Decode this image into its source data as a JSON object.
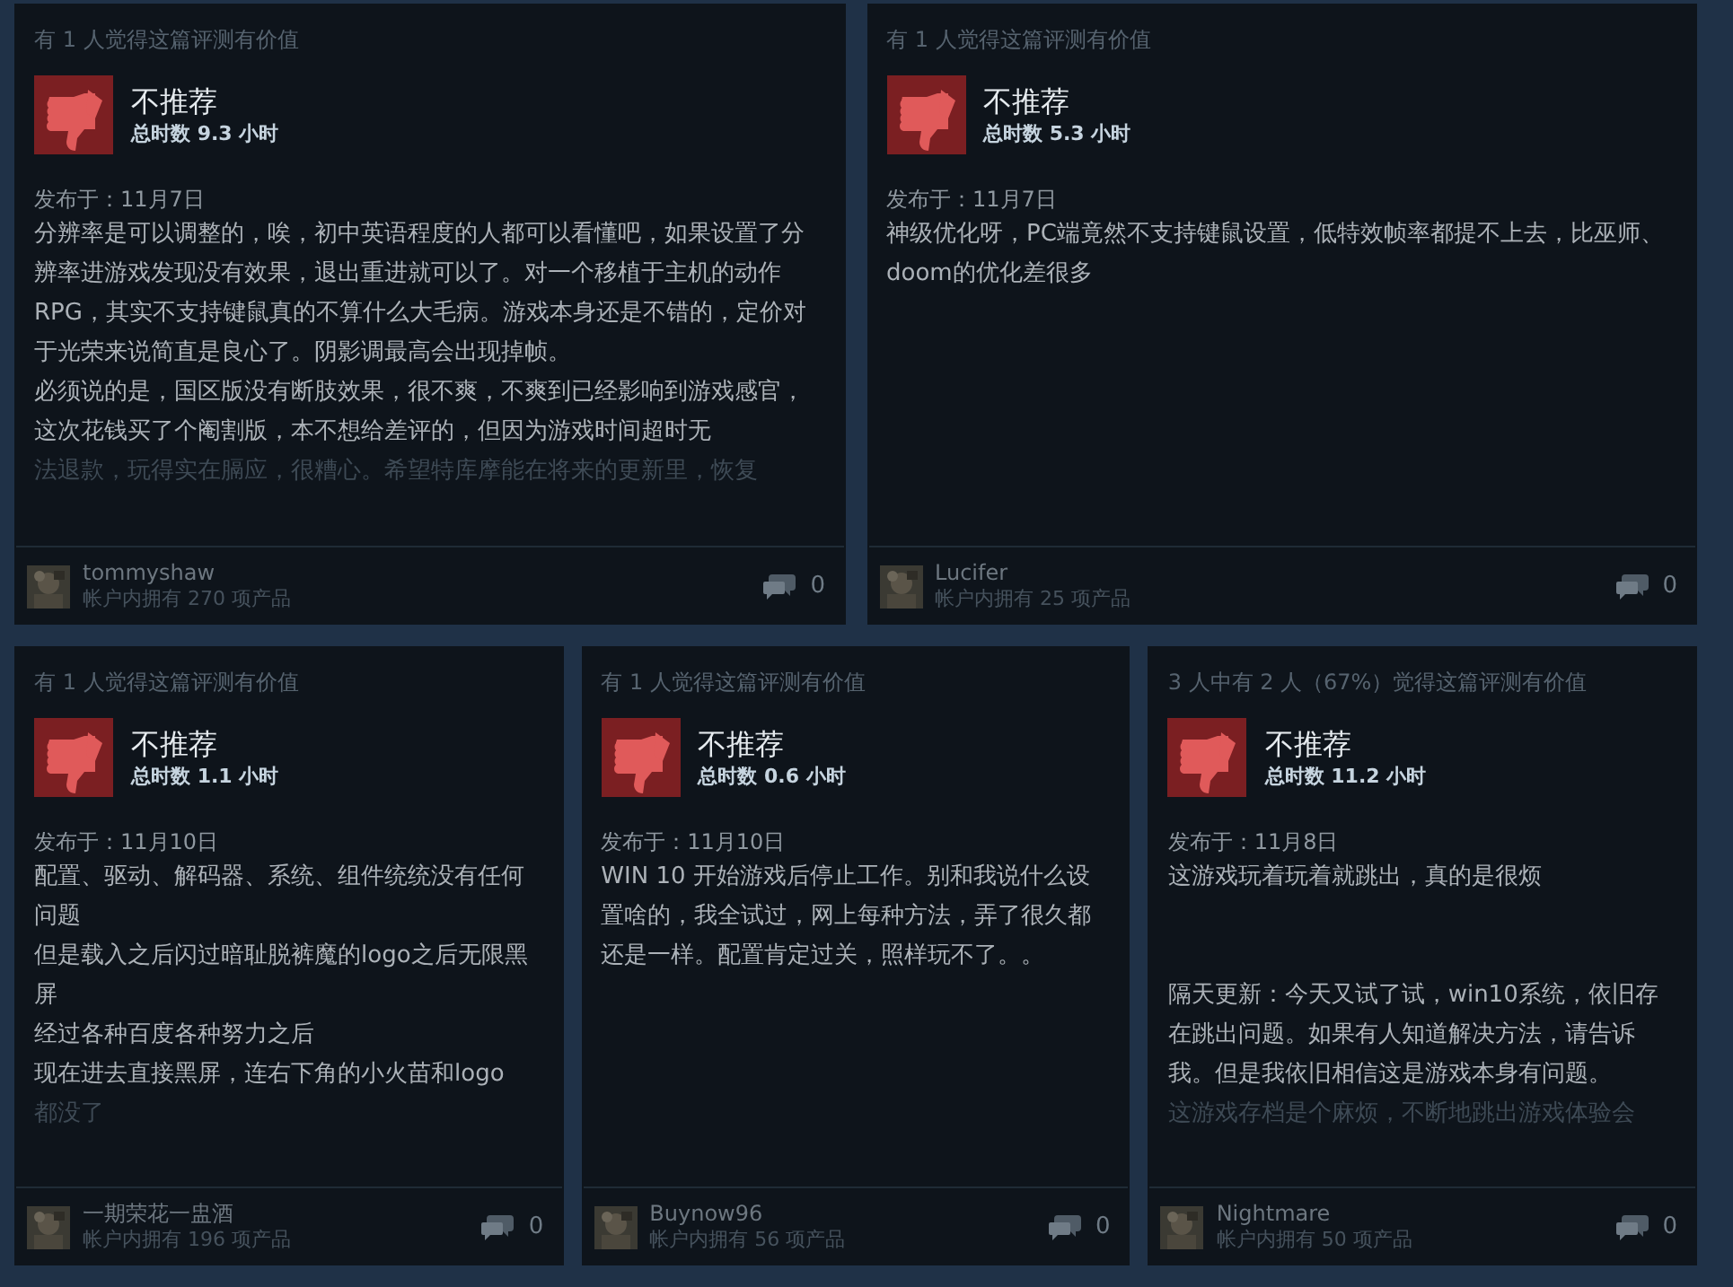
{
  "reviews": [
    {
      "helpful": "有 1 人觉得这篇评测有价值",
      "verdict": "不推荐",
      "playtime": "总时数 9.3 小时",
      "date": "发布于：11月7日",
      "sections": [
        [
          "分辨率是可以调整的，唉，初中英语程度的人都可以看懂吧，如果设置了分辨率进游戏发现没有效果，退出重进就可以了。对一个移植于主机的动作RPG，其实不支持键鼠真的不算什么大毛病。游戏本身还是不错的，定价对于光荣来说简直是良心了。阴影调最高会出现掉帧。",
          "必须说的是，国区版没有断肢效果，很不爽，不爽到已经影响到游戏感官，这次花钱买了个阉割版，本不想给差评的，但因为游戏时间超时无"
        ]
      ],
      "faded_line": "法退款，玩得实在膈应，很糟心。希望特库摩能在将来的更新里，恢复",
      "user": "tommyshaw",
      "products": "帐户内拥有 270 项产品",
      "comments": "0"
    },
    {
      "helpful": "有 1 人觉得这篇评测有价值",
      "verdict": "不推荐",
      "playtime": "总时数 5.3 小时",
      "date": "发布于：11月7日",
      "sections": [
        [
          "神级优化呀，PC端竟然不支持键鼠设置，低特效帧率都提不上去，比巫师、doom的优化差很多"
        ]
      ],
      "user": "Lucifer",
      "products": "帐户内拥有 25 项产品",
      "comments": "0"
    },
    {
      "helpful": "有 1 人觉得这篇评测有价值",
      "verdict": "不推荐",
      "playtime": "总时数 1.1 小时",
      "date": "发布于：11月10日",
      "sections": [
        [
          "配置、驱动、解码器、系统、组件统统没有任何问题",
          "但是载入之后闪过暗耻脱裤魔的logo之后无限黑屏",
          "经过各种百度各种努力之后",
          "现在进去直接黑屏，连右下角的小火苗和logo"
        ]
      ],
      "faded_line": "都没了",
      "user": "一期荣花一盅酒",
      "products": "帐户内拥有 196 项产品",
      "comments": "0"
    },
    {
      "helpful": "有 1 人觉得这篇评测有价值",
      "verdict": "不推荐",
      "playtime": "总时数 0.6 小时",
      "date": "发布于：11月10日",
      "sections": [
        [
          "WIN 10 开始游戏后停止工作。别和我说什么设置啥的，我全试过，网上每种方法，弄了很久都还是一样。配置肯定过关，照样玩不了。。"
        ]
      ],
      "user": "Buynow96",
      "products": "帐户内拥有 56 项产品",
      "comments": "0"
    },
    {
      "helpful": "3 人中有 2 人（67%）觉得这篇评测有价值",
      "verdict": "不推荐",
      "playtime": "总时数 11.2 小时",
      "date": "发布于：11月8日",
      "sections": [
        [
          "这游戏玩着玩着就跳出，真的是很烦"
        ],
        [
          "隔天更新：今天又试了试，win10系统，依旧存在跳出问题。如果有人知道解决方法，请告诉我。但是我依旧相信这是游戏本身有问题。"
        ]
      ],
      "faded_line": "这游戏存档是个麻烦，不断地跳出游戏体验会",
      "user": "Nightmare",
      "products": "帐户内拥有 50 项产品",
      "comments": "0"
    }
  ]
}
